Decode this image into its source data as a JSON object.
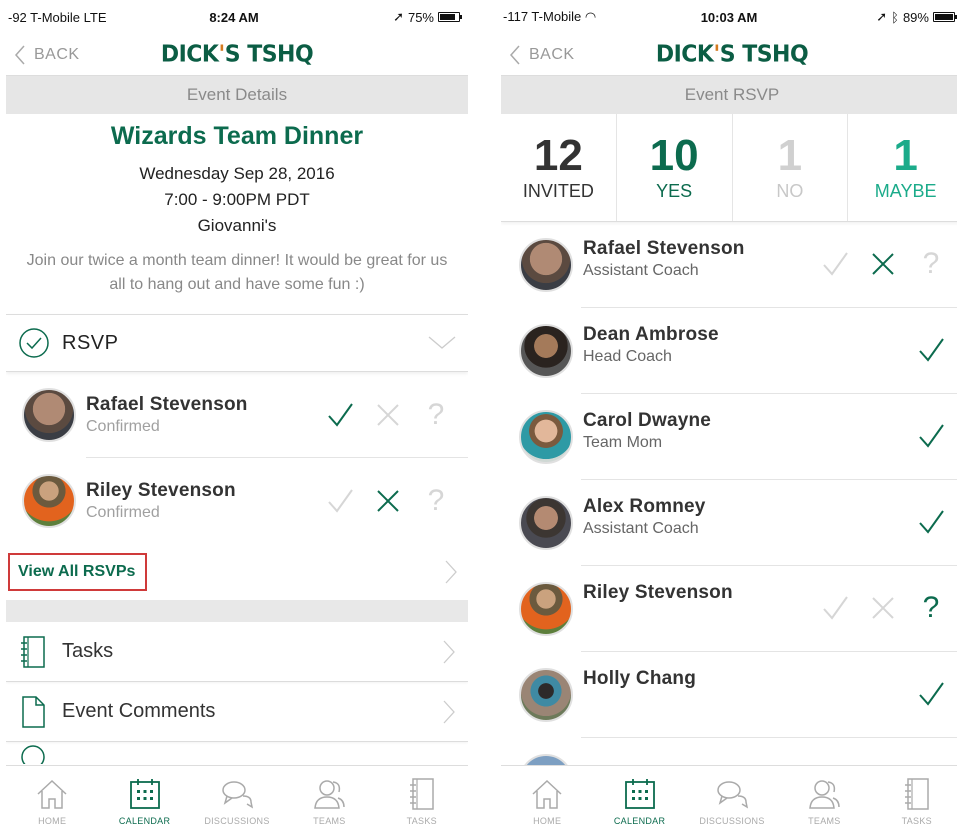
{
  "left": {
    "status": {
      "carrier": "-92 T-Mobile  LTE",
      "time": "8:24 AM",
      "battery": "75%",
      "battery_level": 0.75
    },
    "nav": {
      "back": "BACK",
      "logo_a": "DICK",
      "logo_apos": "'",
      "logo_b": "S TSHQ"
    },
    "section": "Event Details",
    "event": {
      "title": "Wizards Team Dinner",
      "date": "Wednesday Sep 28, 2016",
      "time": "7:00 - 9:00PM PDT",
      "place": "Giovanni's",
      "description": "Join our twice a month team dinner! It would be great for us all to hang out and have some fun :)"
    },
    "rsvp_label": "RSVP",
    "people": [
      {
        "name": "Rafael Stevenson",
        "status": "Confirmed",
        "response": "yes"
      },
      {
        "name": "Riley Stevenson",
        "status": "Confirmed",
        "response": "no"
      }
    ],
    "view_all": "View All RSVPs",
    "menu": [
      {
        "label": "Tasks",
        "icon": "notebook-icon"
      },
      {
        "label": "Event Comments",
        "icon": "document-icon"
      }
    ]
  },
  "right": {
    "status": {
      "carrier": "-117 T-Mobile",
      "time": "10:03 AM",
      "battery": "89%",
      "battery_level": 0.89
    },
    "nav": {
      "back": "BACK",
      "logo_a": "DICK",
      "logo_apos": "'",
      "logo_b": "S TSHQ"
    },
    "section": "Event RSVP",
    "counts": [
      {
        "num": "12",
        "label": "INVITED"
      },
      {
        "num": "10",
        "label": "YES"
      },
      {
        "num": "1",
        "label": "NO"
      },
      {
        "num": "1",
        "label": "MAYBE"
      }
    ],
    "people": [
      {
        "name": "Rafael Stevenson",
        "role": "Assistant Coach",
        "response": "no"
      },
      {
        "name": "Dean Ambrose",
        "role": "Head Coach",
        "response": "yes"
      },
      {
        "name": "Carol Dwayne",
        "role": "Team Mom",
        "response": "yes"
      },
      {
        "name": "Alex Romney",
        "role": "Assistant Coach",
        "response": "yes"
      },
      {
        "name": "Riley Stevenson",
        "role": "",
        "response": "maybe"
      },
      {
        "name": "Holly Chang",
        "role": "",
        "response": "yes"
      }
    ]
  },
  "tabs": [
    {
      "label": "HOME",
      "icon": "home-icon"
    },
    {
      "label": "CALENDAR",
      "icon": "calendar-icon",
      "active": true
    },
    {
      "label": "DISCUSSIONS",
      "icon": "chat-icon"
    },
    {
      "label": "TEAMS",
      "icon": "people-icon"
    },
    {
      "label": "TASKS",
      "icon": "notebook-icon"
    }
  ],
  "colors": {
    "brand": "#0c6b4e",
    "maybe": "#1bab8a",
    "highlight": "#cf3a3a"
  }
}
